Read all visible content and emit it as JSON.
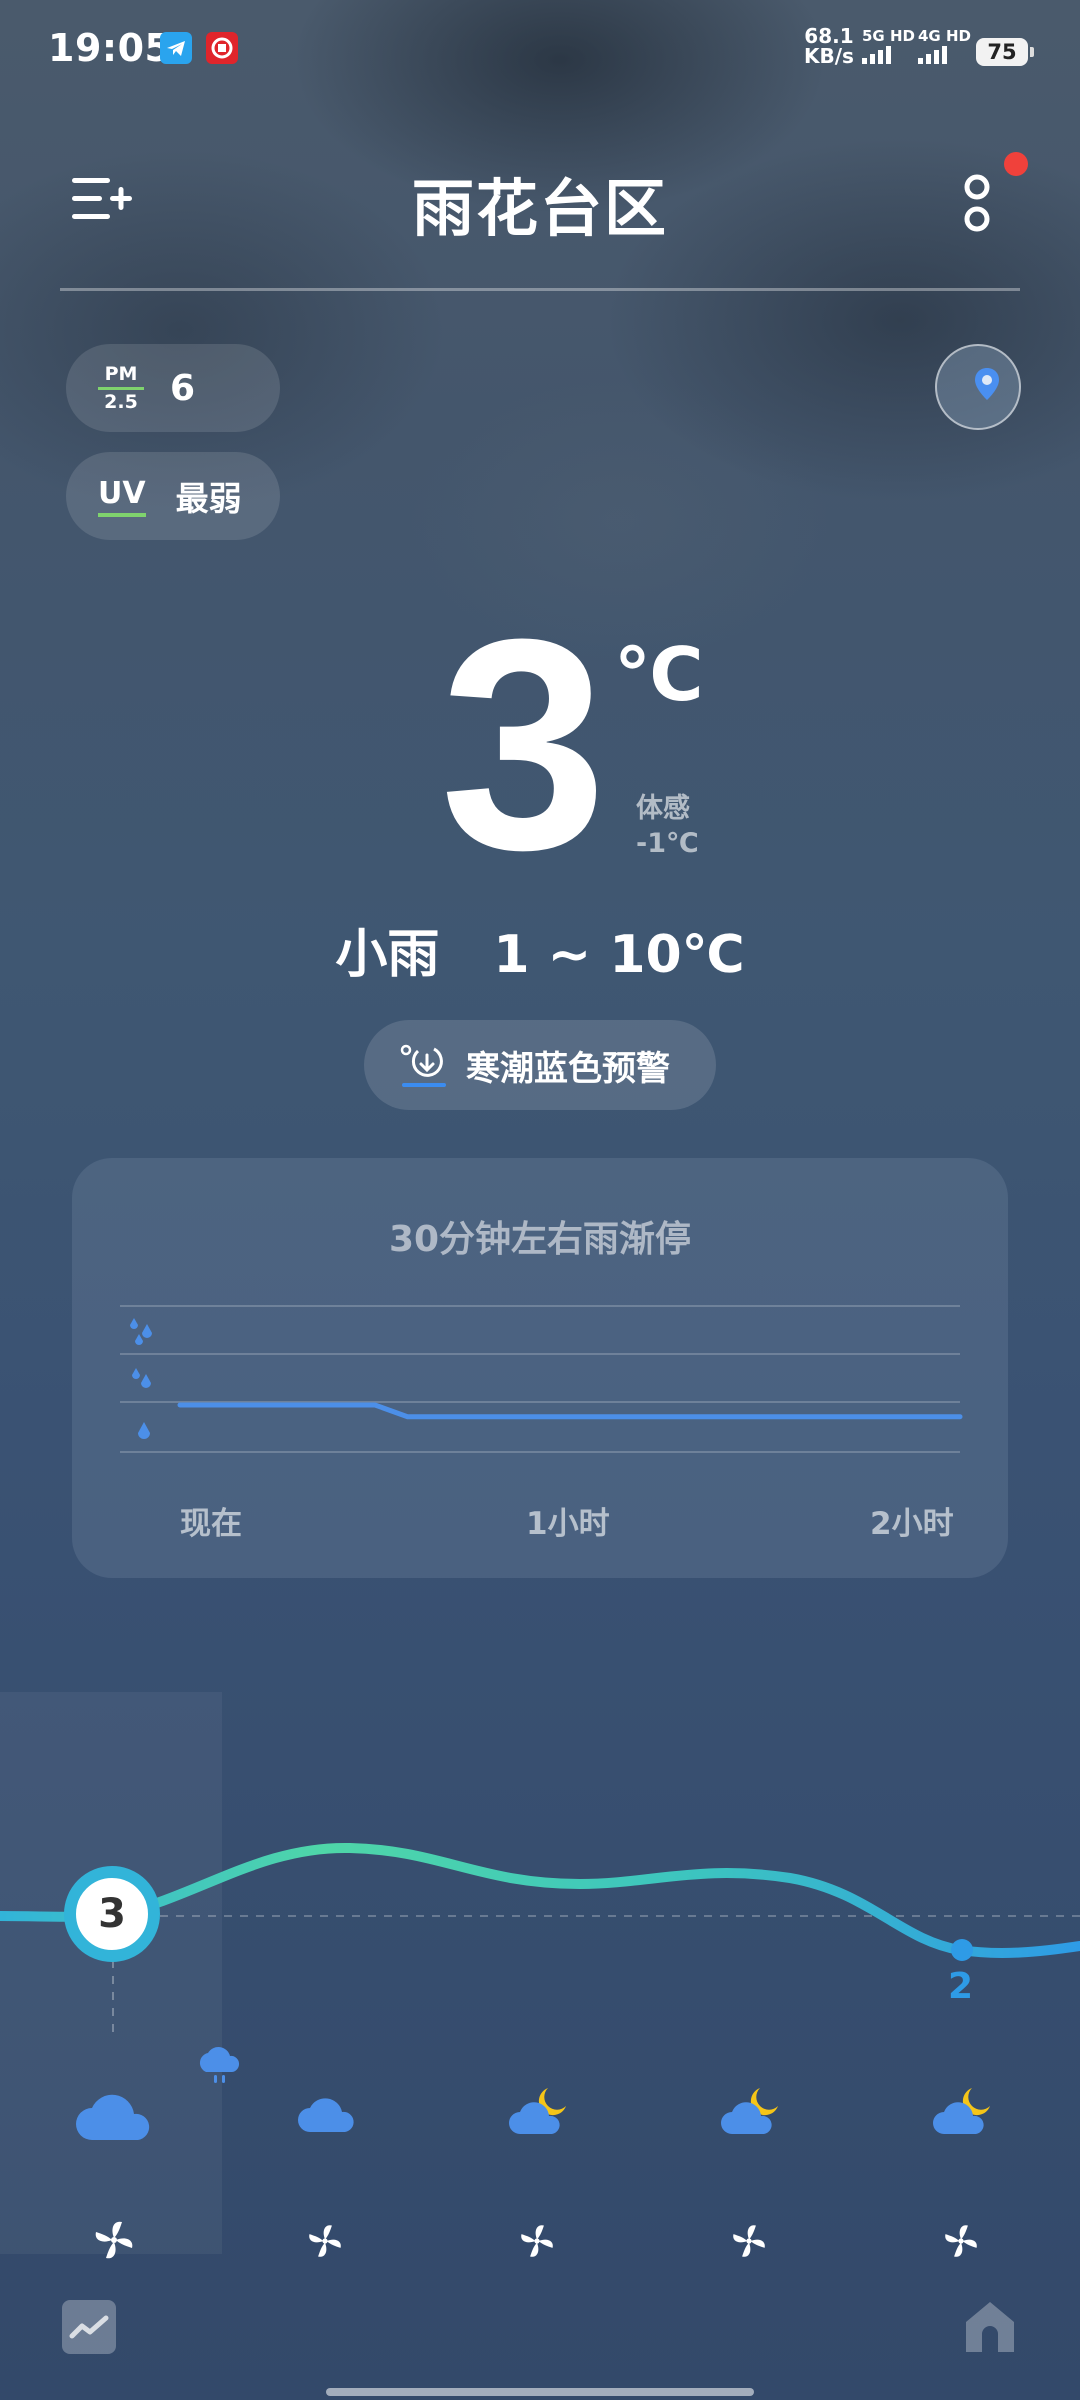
{
  "status": {
    "time": "19:05",
    "net_speed_value": "68.1",
    "net_speed_unit": "KB/s",
    "sim1_label": "5G HD",
    "sim2_label": "4G HD",
    "battery": "75"
  },
  "header": {
    "title": "雨花台区"
  },
  "air": {
    "pm_top": "PM",
    "pm_bottom": "2.5",
    "pm_value": "6",
    "uv_label": "UV",
    "uv_value": "最弱"
  },
  "current": {
    "temperature": "3",
    "unit": "℃",
    "feels_label": "体感",
    "feels_value": "-1℃",
    "condition": "小雨",
    "range": "1 ~ 10℃",
    "alert": "寒潮蓝色预警"
  },
  "rain_card": {
    "title": "30分钟左右雨渐停",
    "ticks": [
      "现在",
      "1小时",
      "2小时"
    ]
  },
  "hourly": {
    "current_temp": "3",
    "end_temp": "2",
    "icons": [
      "cloud-rain",
      "cloud",
      "cloud-night",
      "cloud-night",
      "cloud-night"
    ]
  },
  "chart_data": {
    "type": "line",
    "title": "30分钟左右雨渐停",
    "xlabel": "",
    "ylabel": "",
    "categories": [
      "现在",
      "1小时",
      "2小时"
    ],
    "x": [
      0,
      30,
      35,
      120
    ],
    "series": [
      {
        "values": [
          1,
          1,
          0.75,
          0.75
        ]
      }
    ],
    "ylim": [
      0,
      4
    ],
    "grid": true
  },
  "colors": {
    "accent_green": "#7fd36d",
    "alert_red": "#f0413b",
    "rain_line": "#4c8fe8",
    "temp_curve_start": "#32b4d9",
    "temp_curve_mid": "#4fd6a8",
    "temp_curve_end": "#2e9be6"
  }
}
